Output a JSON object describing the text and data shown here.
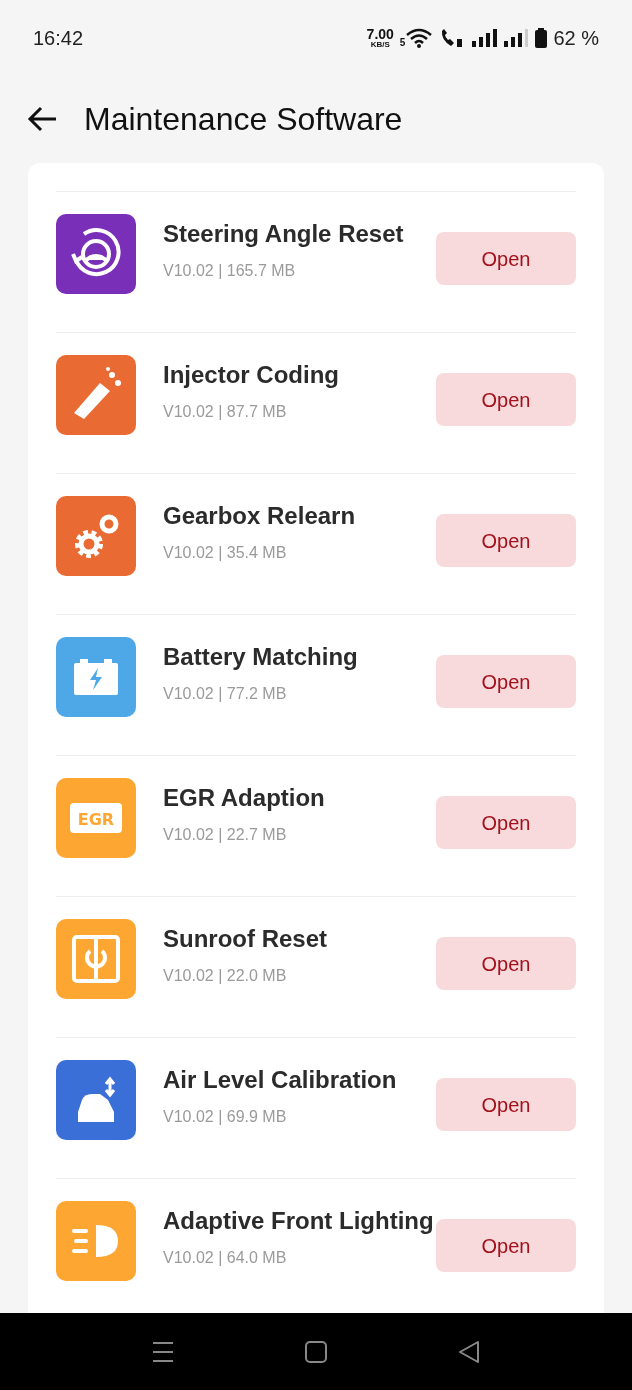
{
  "status_bar": {
    "time": "16:42",
    "speed": "7.00",
    "speed_unit": "KB/S",
    "network": "5",
    "battery": "62 %"
  },
  "header": {
    "title": "Maintenance Software"
  },
  "apps": [
    {
      "name": "Steering Angle Reset",
      "info": "V10.02 | 165.7 MB",
      "kind": "steering",
      "color": "#7a2fb8",
      "action": "Open"
    },
    {
      "name": "Injector Coding",
      "info": "V10.02 | 87.7 MB",
      "kind": "injector",
      "color": "#ea6a33",
      "action": "Open"
    },
    {
      "name": "Gearbox Relearn",
      "info": "V10.02 | 35.4 MB",
      "kind": "gears",
      "color": "#ea6a33",
      "action": "Open"
    },
    {
      "name": "Battery Matching",
      "info": "V10.02 | 77.2 MB",
      "kind": "battery",
      "color": "#4ea8e8",
      "action": "Open"
    },
    {
      "name": "EGR Adaption",
      "info": "V10.02 | 22.7 MB",
      "kind": "egr",
      "icon_text": "EGR",
      "color": "#fda632",
      "action": "Open"
    },
    {
      "name": "Sunroof Reset",
      "info": "V10.02 | 22.0 MB",
      "kind": "sunroof",
      "color": "#fda632",
      "action": "Open"
    },
    {
      "name": "Air Level Calibration",
      "info": "V10.02 | 69.9 MB",
      "kind": "car",
      "color": "#3b6fd8",
      "action": "Open"
    },
    {
      "name": "Adaptive Front Lighting",
      "info": "V10.02 | 64.0 MB",
      "kind": "headlight",
      "color": "#fda632",
      "action": "Open"
    }
  ]
}
